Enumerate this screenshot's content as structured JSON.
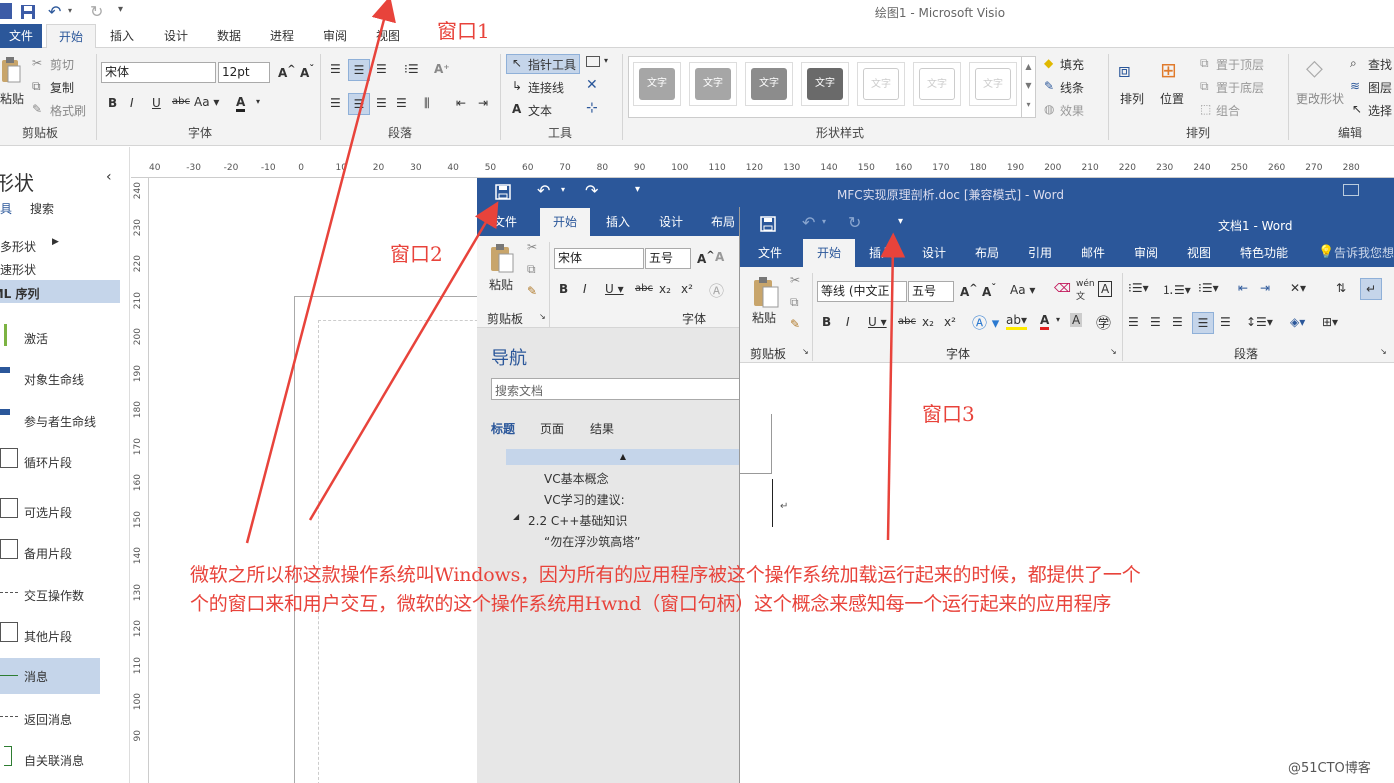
{
  "visio": {
    "title": "绘图1 - Microsoft Visio",
    "tabs": [
      "文件",
      "开始",
      "插入",
      "设计",
      "数据",
      "进程",
      "审阅",
      "视图"
    ],
    "clipboard": {
      "paste": "粘贴",
      "cut": "剪切",
      "copy": "复制",
      "format_painter": "格式刷",
      "group": "剪贴板"
    },
    "font": {
      "name": "宋体",
      "size": "12pt",
      "group": "字体"
    },
    "paragraph": {
      "group": "段落"
    },
    "tools": {
      "pointer": "指针工具",
      "connector": "连接线",
      "text": "文本",
      "group": "工具"
    },
    "shape_styles": {
      "group": "形状样式",
      "tile_text": "文字"
    },
    "fill": {
      "fill": "填充",
      "line": "线条",
      "effect": "效果"
    },
    "arrange": {
      "group": "排列",
      "arrange": "排列",
      "position": "位置",
      "bring_front": "置于顶层",
      "send_back": "置于底层",
      "group_cmd": "组合"
    },
    "edit": {
      "group": "编辑",
      "change_shape": "更改形状",
      "find": "查找",
      "layer": "图层",
      "select": "选择"
    },
    "shapes_panel": {
      "title": "形状",
      "tab_shapes": "模具",
      "tab_search": "搜索",
      "more": "更多形状",
      "quick": "快速形状",
      "section": "UML 序列",
      "items": [
        "激活",
        "对象生命线",
        "参与者生命线",
        "循环片段",
        "可选片段",
        "备用片段",
        "交互操作数",
        "其他片段",
        "消息",
        "返回消息",
        "自关联消息"
      ]
    },
    "ruler_top": [
      "40",
      "-30",
      "-20",
      "-10",
      "0",
      "10",
      "20",
      "30",
      "40",
      "50",
      "60",
      "70",
      "80",
      "90",
      "100",
      "110",
      "120",
      "130",
      "140",
      "150",
      "160",
      "170",
      "180",
      "190",
      "200",
      "210",
      "220",
      "230",
      "240",
      "250",
      "260",
      "270",
      "280"
    ],
    "ruler_left": [
      "240",
      "230",
      "220",
      "210",
      "200",
      "190",
      "180",
      "170",
      "160",
      "150",
      "140",
      "130",
      "120",
      "110",
      "100",
      "90"
    ]
  },
  "word2": {
    "title": "MFC实现原理剖析.doc [兼容模式] - Word",
    "tabs": [
      "文件",
      "开始",
      "插入",
      "设计",
      "布局"
    ],
    "paste": "粘贴",
    "font_name": "宋体",
    "font_size": "五号",
    "clipboard_label": "剪贴板",
    "font_label": "字体",
    "nav": {
      "title": "导航",
      "search_placeholder": "搜索文档",
      "tabs": [
        "标题",
        "页面",
        "结果"
      ],
      "items": [
        "VC基本概念",
        "VC学习的建议:",
        "2.2 C++基础知识",
        "“勿在浮沙筑高塔”"
      ]
    }
  },
  "word3": {
    "title": "文档1 - Word",
    "tabs": [
      "文件",
      "开始",
      "插入",
      "设计",
      "布局",
      "引用",
      "邮件",
      "审阅",
      "视图",
      "特色功能"
    ],
    "tell_me": "告诉我您想",
    "paste": "粘贴",
    "font_name": "等线 (中文正",
    "font_size": "五号",
    "clipboard_label": "剪贴板",
    "font_label": "字体",
    "paragraph_label": "段落"
  },
  "annotations": {
    "window1": "窗口1",
    "window2": "窗口2",
    "window3": "窗口3",
    "line1": "微软之所以称这款操作系统叫Windows，因为所有的应用程序被这个操作系统加载运行起来的时候，都提供了一个",
    "line2": "个的窗口来和用户交互，微软的这个操作系统用Hwnd（窗口句柄）这个概念来感知每一个运行起来的应用程序",
    "watermark": "@51CTO博客"
  },
  "colors": {
    "word_blue": "#2b579a",
    "annotation_red": "#e8433b"
  }
}
